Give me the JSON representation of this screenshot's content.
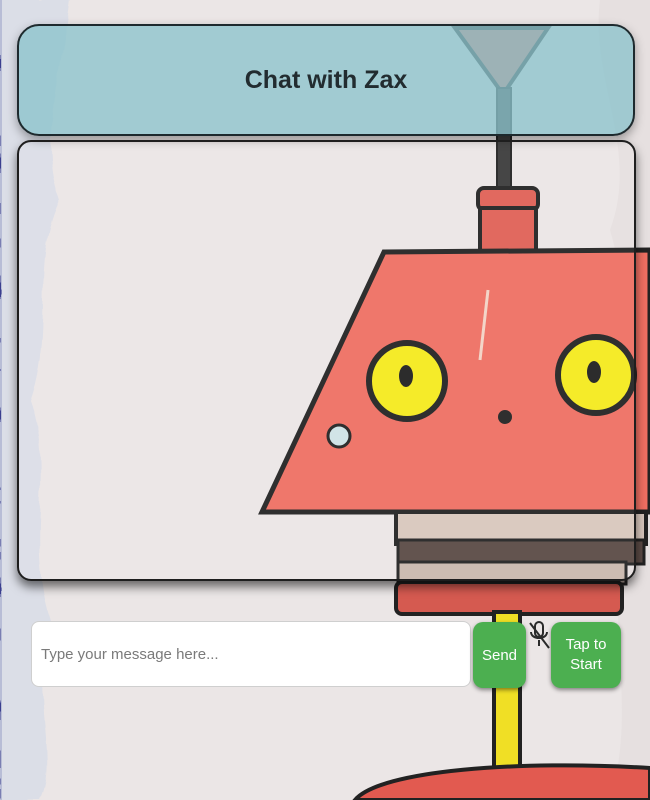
{
  "header": {
    "title": "Chat with Zax"
  },
  "chat": {
    "messages": []
  },
  "composer": {
    "placeholder": "Type your message here...",
    "value": "",
    "send_label": "Send",
    "mic_icon": "mic-off-icon",
    "start_label": "Tap to Start"
  },
  "colors": {
    "header_bg": "#8cc3cc",
    "button_bg": "#4caf50",
    "robot_body": "#ef6f62",
    "robot_eye": "#f5ea1c"
  }
}
